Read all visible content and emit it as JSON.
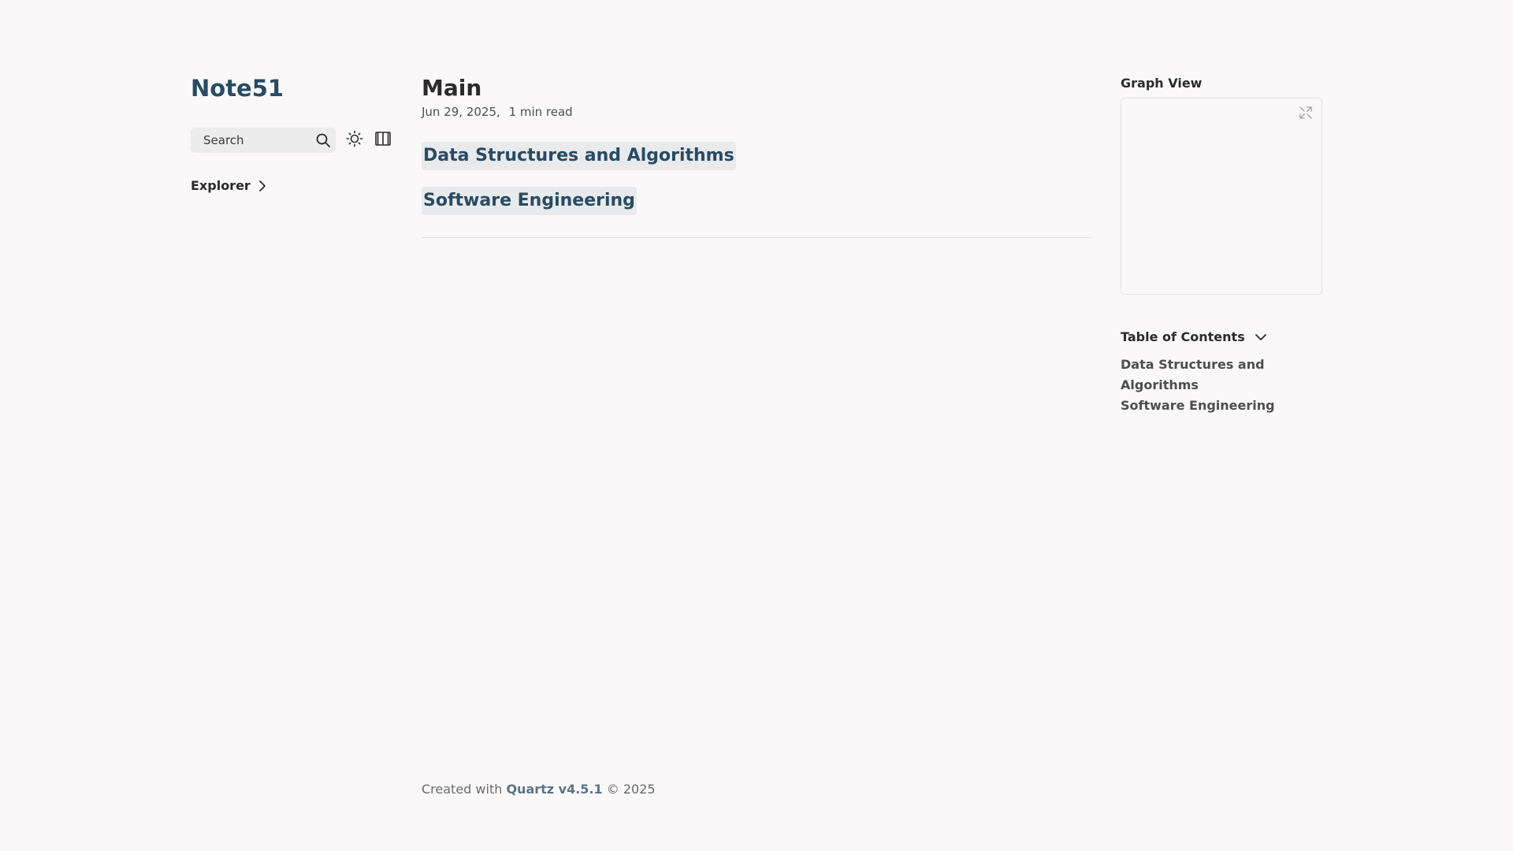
{
  "site": {
    "title": "Note51"
  },
  "toolbar": {
    "search_label": "Search",
    "search_icon": "search-icon",
    "theme_icon": "sun-icon",
    "reader_icon": "book-icon"
  },
  "explorer": {
    "label": "Explorer",
    "icon": "chevron-right-icon"
  },
  "article": {
    "title": "Main",
    "date": "Jun 29, 2025,",
    "read_time": "1 min read",
    "links": [
      {
        "label": "Data Structures and Algorithms"
      },
      {
        "label": "Software Engineering"
      }
    ]
  },
  "footer": {
    "prefix": "Created with",
    "link_label": "Quartz v4.5.1",
    "suffix": "© 2025"
  },
  "graph": {
    "title": "Graph View",
    "expand_icon": "expand-icon"
  },
  "toc": {
    "title": "Table of Contents",
    "icon": "chevron-down-icon",
    "items": [
      {
        "label": "Data Structures and Algorithms"
      },
      {
        "label": "Software Engineering"
      }
    ]
  },
  "colors": {
    "accent": "#284b63",
    "background": "#faf8f8",
    "text": "#2b2b2b"
  }
}
